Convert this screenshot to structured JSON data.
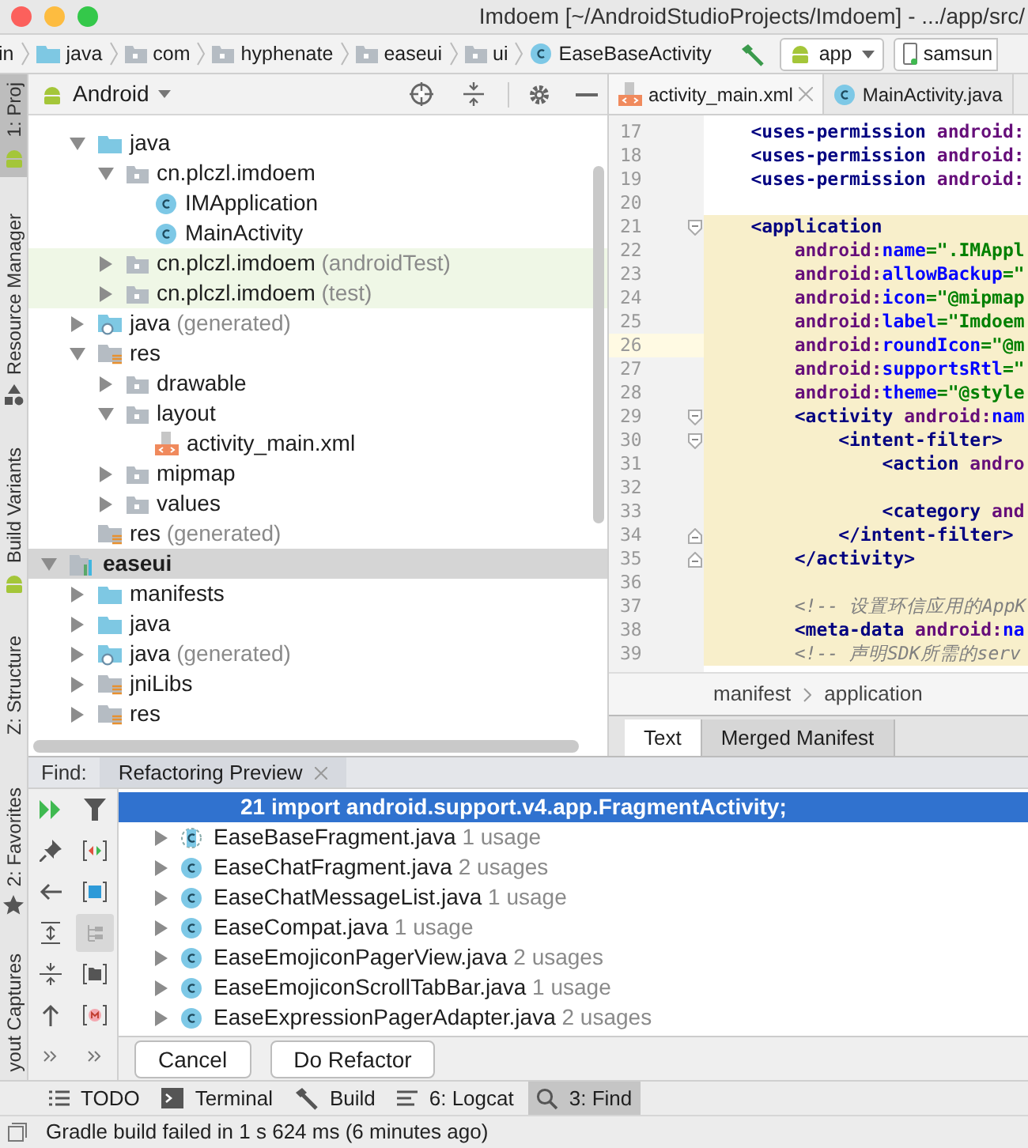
{
  "window": {
    "title": "Imdoem [~/AndroidStudioProjects/Imdoem] - .../app/src/"
  },
  "navigation_bar": {
    "breadcrumbs": [
      {
        "label": "in",
        "kind": "plain"
      },
      {
        "label": "java",
        "kind": "source_folder"
      },
      {
        "label": "com",
        "kind": "package"
      },
      {
        "label": "hyphenate",
        "kind": "package"
      },
      {
        "label": "easeui",
        "kind": "package"
      },
      {
        "label": "ui",
        "kind": "package"
      },
      {
        "label": "EaseBaseActivity",
        "kind": "class"
      }
    ],
    "run_configuration": "app",
    "device": "samsun"
  },
  "side_tool_tabs_top": [
    {
      "label": "1: Proj",
      "selected": true,
      "kind": "android"
    },
    {
      "label": "Resource Manager",
      "selected": false,
      "kind": "shapes"
    },
    {
      "label": "Build Variants",
      "selected": false,
      "kind": "android"
    },
    {
      "label": "Z: Structure",
      "selected": false,
      "kind": "plain"
    }
  ],
  "side_tool_tabs_bottom": [
    {
      "label": "2: Favorites",
      "selected": false,
      "kind": "star"
    },
    {
      "label": "yout Captures",
      "selected": false,
      "kind": "plain"
    }
  ],
  "project_panel": {
    "view": "Android",
    "scrolled_module_children": [
      {
        "label": "java",
        "kind": "source_folder",
        "expanded": true,
        "selected": false,
        "tinted": false,
        "children": [
          {
            "label": "cn.plczl.imdoem",
            "kind": "package",
            "expanded": true,
            "selected": false,
            "tinted": false,
            "children": [
              {
                "label": "IMApplication",
                "kind": "class",
                "selected": false,
                "tinted": false
              },
              {
                "label": "MainActivity",
                "kind": "class",
                "selected": false,
                "tinted": false
              }
            ]
          },
          {
            "label": "cn.plczl.imdoem",
            "suffix": "(androidTest)",
            "kind": "package",
            "expanded": false,
            "selected": false,
            "tinted": true
          },
          {
            "label": "cn.plczl.imdoem",
            "suffix": "(test)",
            "kind": "package",
            "expanded": false,
            "selected": false,
            "tinted": true
          }
        ]
      },
      {
        "label": "java",
        "suffix": "(generated)",
        "kind": "generated_folder",
        "expanded": false,
        "selected": false,
        "tinted": false
      },
      {
        "label": "res",
        "kind": "resource_folder",
        "expanded": true,
        "selected": false,
        "tinted": false,
        "children": [
          {
            "label": "drawable",
            "kind": "package",
            "expanded": false,
            "selected": false,
            "tinted": false
          },
          {
            "label": "layout",
            "kind": "package",
            "expanded": true,
            "selected": false,
            "tinted": false,
            "children": [
              {
                "label": "activity_main.xml",
                "kind": "xml_file",
                "selected": false,
                "tinted": false
              }
            ]
          },
          {
            "label": "mipmap",
            "kind": "package",
            "expanded": false,
            "selected": false,
            "tinted": false
          },
          {
            "label": "values",
            "kind": "package",
            "expanded": false,
            "selected": false,
            "tinted": false
          }
        ]
      },
      {
        "label": "res",
        "suffix": "(generated)",
        "kind": "resource_folder",
        "selected": false,
        "tinted": false
      }
    ],
    "modules": [
      {
        "label": "easeui",
        "kind": "module",
        "expanded": true,
        "selected": true,
        "children": [
          {
            "label": "manifests",
            "kind": "source_folder",
            "expanded": false,
            "selected": false,
            "tinted": false
          },
          {
            "label": "java",
            "kind": "source_folder",
            "expanded": false,
            "selected": false,
            "tinted": false
          },
          {
            "label": "java",
            "suffix": "(generated)",
            "kind": "generated_folder",
            "expanded": false,
            "selected": false,
            "tinted": false
          },
          {
            "label": "jniLibs",
            "kind": "resource_folder",
            "expanded": false,
            "selected": false,
            "tinted": false
          },
          {
            "label": "res",
            "kind": "resource_folder",
            "expanded": false,
            "selected": false,
            "tinted": false
          }
        ]
      }
    ]
  },
  "editor": {
    "tabs": [
      {
        "label": "activity_main.xml",
        "kind": "xml_file",
        "selected": true,
        "closable": true
      },
      {
        "label": "MainActivity.java",
        "kind": "class",
        "selected": false,
        "closable": false
      }
    ],
    "lines": [
      {
        "number": "17",
        "highlighted": false,
        "current": false,
        "kind": "plain",
        "tokens": [
          {
            "kind": "tag",
            "text": "    <uses-permission"
          },
          {
            "kind": "ns",
            "text": " android:"
          }
        ]
      },
      {
        "number": "18",
        "highlighted": false,
        "current": false,
        "kind": "plain",
        "tokens": [
          {
            "kind": "tag",
            "text": "    <uses-permission"
          },
          {
            "kind": "ns",
            "text": " android:"
          }
        ]
      },
      {
        "number": "19",
        "highlighted": false,
        "current": false,
        "kind": "plain",
        "tokens": [
          {
            "kind": "tag",
            "text": "    <uses-permission"
          },
          {
            "kind": "ns",
            "text": " android:"
          }
        ]
      },
      {
        "number": "20",
        "highlighted": false,
        "current": false,
        "kind": "plain"
      },
      {
        "number": "21",
        "highlighted": true,
        "current": false,
        "kind": "fold_start",
        "tokens": [
          {
            "kind": "tag",
            "text": "    <application"
          }
        ]
      },
      {
        "number": "22",
        "highlighted": true,
        "current": false,
        "kind": "plain",
        "tokens": [
          {
            "kind": "ns",
            "text": "        android:"
          },
          {
            "kind": "attr",
            "text": "name"
          },
          {
            "kind": "value",
            "text": "=\".IMAppl"
          }
        ]
      },
      {
        "number": "23",
        "highlighted": true,
        "current": false,
        "kind": "plain",
        "tokens": [
          {
            "kind": "ns",
            "text": "        android:"
          },
          {
            "kind": "attr",
            "text": "allowBackup"
          },
          {
            "kind": "value",
            "text": "=\""
          }
        ]
      },
      {
        "number": "24",
        "highlighted": true,
        "current": false,
        "kind": "plain",
        "tokens": [
          {
            "kind": "ns",
            "text": "        android:"
          },
          {
            "kind": "attr",
            "text": "icon"
          },
          {
            "kind": "value",
            "text": "=\"@mipmap"
          }
        ]
      },
      {
        "number": "25",
        "highlighted": true,
        "current": false,
        "kind": "plain",
        "tokens": [
          {
            "kind": "ns",
            "text": "        android:"
          },
          {
            "kind": "attr",
            "text": "label"
          },
          {
            "kind": "value",
            "text": "=\"Imdoem"
          }
        ]
      },
      {
        "number": "26",
        "highlighted": true,
        "current": true,
        "kind": "plain",
        "tokens": [
          {
            "kind": "ns",
            "text": "        android:"
          },
          {
            "kind": "attr",
            "text": "roundIcon"
          },
          {
            "kind": "value",
            "text": "=\"@m"
          }
        ]
      },
      {
        "number": "27",
        "highlighted": true,
        "current": false,
        "kind": "plain",
        "tokens": [
          {
            "kind": "ns",
            "text": "        android:"
          },
          {
            "kind": "attr",
            "text": "supportsRtl"
          },
          {
            "kind": "value",
            "text": "=\""
          }
        ]
      },
      {
        "number": "28",
        "highlighted": true,
        "current": false,
        "kind": "plain",
        "tokens": [
          {
            "kind": "ns",
            "text": "        android:"
          },
          {
            "kind": "attr",
            "text": "theme"
          },
          {
            "kind": "value",
            "text": "=\"@style"
          }
        ]
      },
      {
        "number": "29",
        "highlighted": true,
        "current": false,
        "kind": "fold_start",
        "tokens": [
          {
            "kind": "tag",
            "text": "        <activity"
          },
          {
            "kind": "ns",
            "text": " android:"
          },
          {
            "kind": "attr",
            "text": "nam"
          }
        ]
      },
      {
        "number": "30",
        "highlighted": true,
        "current": false,
        "kind": "fold_start",
        "tokens": [
          {
            "kind": "tag",
            "text": "            <intent-filter>"
          }
        ]
      },
      {
        "number": "31",
        "highlighted": true,
        "current": false,
        "kind": "plain",
        "tokens": [
          {
            "kind": "tag",
            "text": "                <action"
          },
          {
            "kind": "ns",
            "text": " andro"
          }
        ]
      },
      {
        "number": "32",
        "highlighted": true,
        "current": false,
        "kind": "plain"
      },
      {
        "number": "33",
        "highlighted": true,
        "current": false,
        "kind": "plain",
        "tokens": [
          {
            "kind": "tag",
            "text": "                <category"
          },
          {
            "kind": "ns",
            "text": " and"
          }
        ]
      },
      {
        "number": "34",
        "highlighted": true,
        "current": false,
        "kind": "fold_end",
        "tokens": [
          {
            "kind": "tag",
            "text": "            </intent-filter>"
          }
        ]
      },
      {
        "number": "35",
        "highlighted": true,
        "current": false,
        "kind": "fold_end",
        "tokens": [
          {
            "kind": "tag",
            "text": "        </activity>"
          }
        ]
      },
      {
        "number": "36",
        "highlighted": true,
        "current": false,
        "kind": "plain"
      },
      {
        "number": "37",
        "highlighted": true,
        "current": false,
        "kind": "plain",
        "tokens": [
          {
            "kind": "comment",
            "text": "        <!-- 设置环信应用的AppK"
          }
        ]
      },
      {
        "number": "38",
        "highlighted": true,
        "current": false,
        "kind": "plain",
        "tokens": [
          {
            "kind": "tag",
            "text": "        <meta-data"
          },
          {
            "kind": "ns",
            "text": " android:"
          },
          {
            "kind": "attr",
            "text": "na"
          }
        ]
      },
      {
        "number": "39",
        "highlighted": true,
        "current": false,
        "kind": "plain",
        "tokens": [
          {
            "kind": "comment",
            "text": "        <!-- 声明SDK所需的serv"
          }
        ]
      }
    ],
    "breadcrumb": [
      "manifest",
      "application"
    ],
    "mode_tabs": [
      {
        "label": "Text",
        "selected": true
      },
      {
        "label": "Merged Manifest",
        "selected": false
      }
    ]
  },
  "find_panel": {
    "title": "Find:",
    "tabs": [
      {
        "label": "Refactoring Preview",
        "selected": true
      }
    ],
    "toolbar": [
      {
        "kind": "rerun",
        "on": false
      },
      {
        "kind": "filter",
        "on": false
      },
      {
        "kind": "pin",
        "on": false
      },
      {
        "kind": "diff",
        "on": false
      },
      {
        "kind": "back",
        "on": false
      },
      {
        "kind": "square",
        "on": false
      },
      {
        "kind": "expand",
        "on": false
      },
      {
        "kind": "tree",
        "on": true
      },
      {
        "kind": "collapse",
        "on": false
      },
      {
        "kind": "folder",
        "on": false
      },
      {
        "kind": "up",
        "on": false
      },
      {
        "kind": "module",
        "on": false
      }
    ],
    "selected_row": "21 import android.support.v4.app.FragmentActivity;",
    "results": [
      {
        "file": "EaseBaseFragment.java",
        "usages": "1 usage",
        "kind": "abstract_class"
      },
      {
        "file": "EaseChatFragment.java",
        "usages": "2 usages",
        "kind": "class"
      },
      {
        "file": "EaseChatMessageList.java",
        "usages": "1 usage",
        "kind": "class"
      },
      {
        "file": "EaseCompat.java",
        "usages": "1 usage",
        "kind": "class"
      },
      {
        "file": "EaseEmojiconPagerView.java",
        "usages": "2 usages",
        "kind": "class"
      },
      {
        "file": "EaseEmojiconScrollTabBar.java",
        "usages": "1 usage",
        "kind": "class"
      },
      {
        "file": "EaseExpressionPagerAdapter.java",
        "usages": "2 usages",
        "kind": "class"
      }
    ],
    "buttons": [
      "Cancel",
      "Do Refactor"
    ]
  },
  "tool_window_bar": [
    {
      "label": "TODO",
      "kind": "list",
      "selected": false
    },
    {
      "label": "Terminal",
      "kind": "terminal",
      "selected": false
    },
    {
      "label": "Build",
      "kind": "hammer",
      "selected": false
    },
    {
      "label": "6: Logcat",
      "kind": "lines",
      "selected": false
    },
    {
      "label": "3: Find",
      "kind": "search",
      "selected": true
    }
  ],
  "status_bar": {
    "message": "Gradle build failed in 1 s 624 ms (6 minutes ago)"
  }
}
